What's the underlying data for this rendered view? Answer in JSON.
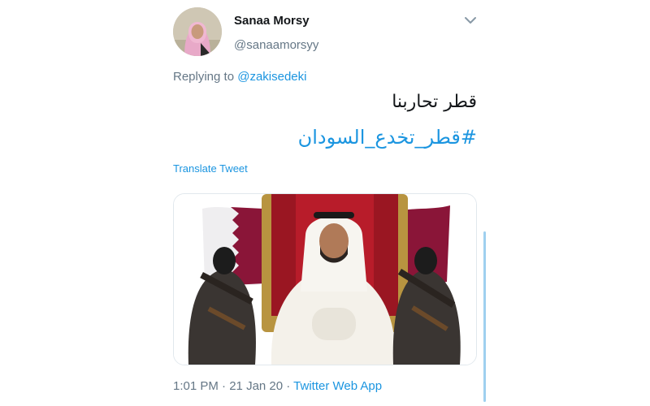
{
  "author": {
    "display_name": "Sanaa Morsy",
    "handle": "@sanaamorsyy"
  },
  "reply": {
    "prefix": "Replying to ",
    "mention": "@zakisedeki"
  },
  "tweet": {
    "text": "قطر تحاربنا",
    "hashtag": "#قطر_تخدع_السودان",
    "translate_label": "Translate Tweet"
  },
  "meta": {
    "time": "1:01 PM",
    "date": "21 Jan 20",
    "separator": " · ",
    "source": "Twitter Web App"
  },
  "colors": {
    "link": "#1b95e0",
    "secondary": "#657786",
    "flag_maroon": "#8a1538"
  },
  "icons": {
    "caret": "chevron-down-icon"
  }
}
